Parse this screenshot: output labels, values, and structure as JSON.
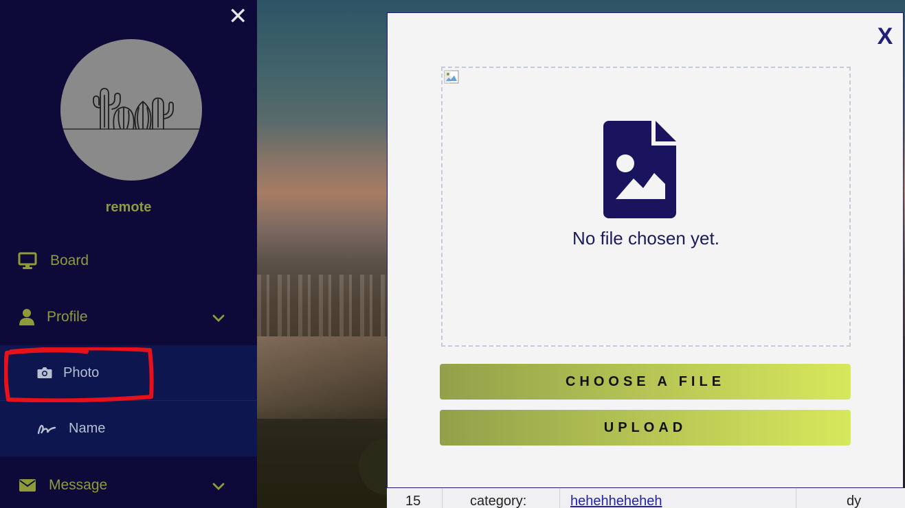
{
  "sidebar": {
    "close_glyph": "✕",
    "username": "remote",
    "menu": {
      "board": "Board",
      "profile": "Profile",
      "photo": "Photo",
      "name": "Name",
      "message": "Message"
    }
  },
  "modal": {
    "close_label": "X",
    "dropzone_text": "No file chosen yet.",
    "choose_button": "CHOOSE A FILE",
    "upload_button": "UPLOAD"
  },
  "table_row": {
    "id": "15",
    "category": "category:",
    "value": "hehehheheheh",
    "last": "dy"
  },
  "colors": {
    "sidebar_bg": "#0d0a3a",
    "submenu_bg": "#0e1650",
    "menu_text": "#8f9a3b",
    "accent_icon": "#1a145e",
    "annotation": "#e8111b"
  }
}
